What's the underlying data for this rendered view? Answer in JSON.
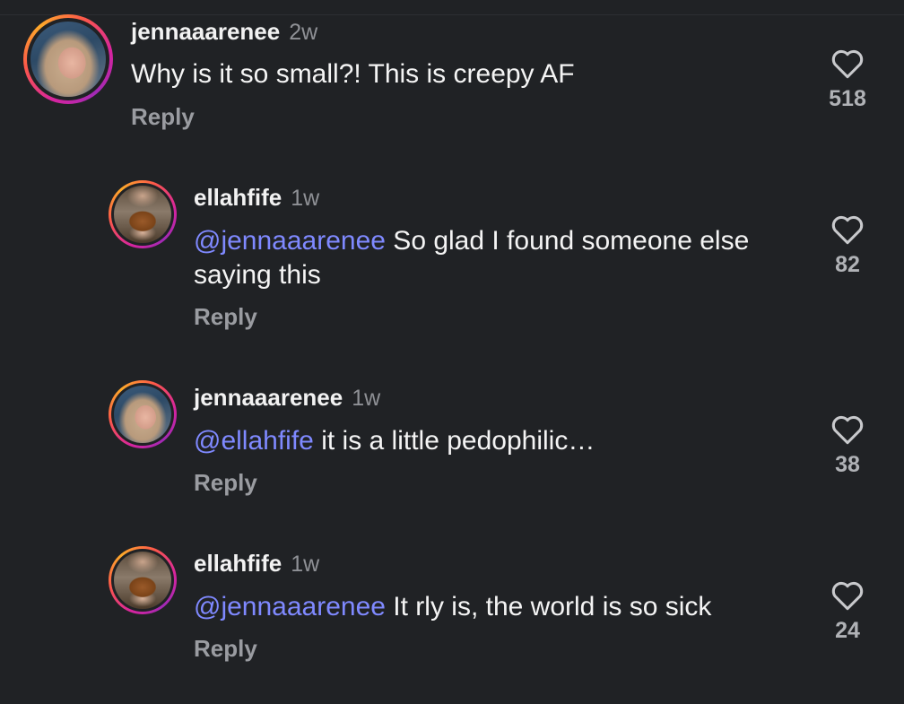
{
  "comments": [
    {
      "username": "jennaaarenee",
      "time": "2w",
      "mention": "",
      "text": "Why is it so small?! This is creepy AF",
      "text_line2": "",
      "reply_label": "Reply",
      "likes": "518",
      "avatar_icon": "user-avatar-jenna"
    },
    {
      "username": "ellahfife",
      "time": "1w",
      "mention": "@jennaaarenee",
      "text": " So glad I found someone else",
      "text_line2": "saying this",
      "reply_label": "Reply",
      "likes": "82",
      "avatar_icon": "user-avatar-ella"
    },
    {
      "username": "jennaaarenee",
      "time": "1w",
      "mention": "@ellahfife",
      "text": " it is a little pedophilic…",
      "text_line2": "",
      "reply_label": "Reply",
      "likes": "38",
      "avatar_icon": "user-avatar-jenna"
    },
    {
      "username": "ellahfife",
      "time": "1w",
      "mention": "@jennaaarenee",
      "text": " It rly is, the world is so sick",
      "text_line2": "",
      "reply_label": "Reply",
      "likes": "24",
      "avatar_icon": "user-avatar-ella"
    }
  ],
  "colors": {
    "background": "#202225",
    "mention": "#7f89ff",
    "muted": "#9a9ca1",
    "like_icon": "#c8c9cc"
  },
  "icons": {
    "like": "heart-outline-icon"
  }
}
